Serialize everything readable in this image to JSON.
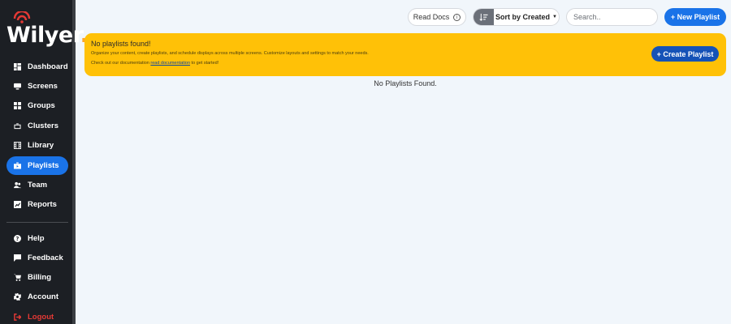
{
  "brand": {
    "name": "Wilyer",
    "dot": "."
  },
  "sidebar": {
    "items": [
      {
        "label": "Dashboard",
        "icon": "dashboard-icon"
      },
      {
        "label": "Screens",
        "icon": "monitor-icon"
      },
      {
        "label": "Groups",
        "icon": "grid-icon"
      },
      {
        "label": "Clusters",
        "icon": "briefcase-icon"
      },
      {
        "label": "Library",
        "icon": "film-icon"
      },
      {
        "label": "Playlists",
        "icon": "playlist-icon",
        "active": true
      },
      {
        "label": "Team",
        "icon": "team-icon"
      },
      {
        "label": "Reports",
        "icon": "report-icon"
      }
    ],
    "footer_items": [
      {
        "label": "Help",
        "icon": "help-icon"
      },
      {
        "label": "Feedback",
        "icon": "feedback-icon"
      },
      {
        "label": "Billing",
        "icon": "cart-icon"
      },
      {
        "label": "Account",
        "icon": "gear-icon"
      },
      {
        "label": "Logout",
        "icon": "logout-icon"
      }
    ]
  },
  "toolbar": {
    "read_docs_label": "Read Docs",
    "info_glyph": "i",
    "sort_label": "Sort by Created",
    "search_placeholder": "Search..",
    "new_playlist_label": "+ New Playlist"
  },
  "banner": {
    "title": "No playlists found!",
    "description": "Organize your content, create playlists, and schedule displays across multiple screens. Customize layouts and settings to match your needs.",
    "doc_prefix": "Check out our documentation",
    "doc_link": "read documentation",
    "doc_suffix": "to get started!",
    "create_label": "+ Create Playlist"
  },
  "empty_message": "No Playlists Found.",
  "colors": {
    "accent": "#1a73e8",
    "banner": "#ffc107",
    "sidebar": "#1c1f24",
    "logout": "#e53935",
    "brand_dot": "#ffa726"
  }
}
